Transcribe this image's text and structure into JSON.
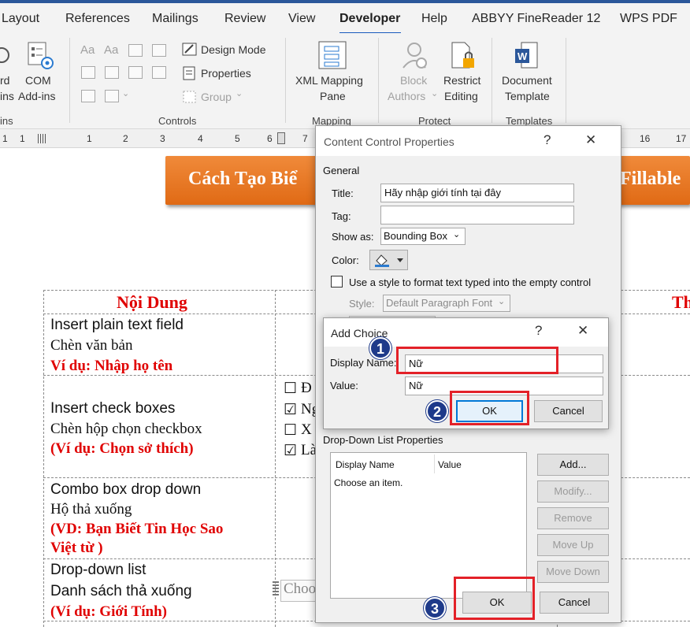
{
  "ribbon": {
    "tabs": [
      "Layout",
      "References",
      "Mailings",
      "Review",
      "View",
      "Developer",
      "Help",
      "ABBYY FineReader 12",
      "WPS PDF"
    ],
    "active_tab": "Developer",
    "addins": {
      "partial_label_1": "rd",
      "partial_label_2": "ins",
      "com_label_1": "COM",
      "com_label_2": "Add-ins",
      "group_partial": "ins"
    },
    "controls": {
      "design_mode": "Design Mode",
      "properties": "Properties",
      "group": "Group",
      "group_label": "Controls"
    },
    "mapping": {
      "xml_label_1": "XML Mapping",
      "xml_label_2": "Pane",
      "group_label": "Mapping"
    },
    "protect": {
      "block_1": "Block",
      "block_2": "Authors",
      "restrict_1": "Restrict",
      "restrict_2": "Editing",
      "group_label": "Protect"
    },
    "templates": {
      "doc_1": "Document",
      "doc_2": "Template",
      "group_label": "Templates"
    }
  },
  "ruler": {
    "left_numbers": [
      "1",
      "1",
      "1",
      "2",
      "3",
      "4",
      "5",
      "6",
      "7"
    ],
    "right_numbers": [
      "16",
      "17"
    ]
  },
  "document": {
    "banner_left": "Cách Tạo Biể",
    "banner_right": "(Fillable",
    "col1_header": "Nội Dung",
    "col3_header_partial": "Th",
    "rows": [
      {
        "line1": "Insert plain text field",
        "line2": "Chèn văn bản",
        "example": "Ví dụ: Nhập họ tên"
      },
      {
        "line1": "Insert check boxes",
        "line2": "Chèn hộp chọn checkbox",
        "example": "(Ví dụ: Chọn sở thích)"
      },
      {
        "line1": "Combo box drop down",
        "line2": "Hộ thả xuống",
        "example1": "(VD: Bạn Biết Tin Học Sao",
        "example2": "Việt từ )"
      },
      {
        "line1": "Drop-down list",
        "line2": "Danh sách thả xuống",
        "example": "(Ví dụ: Giới Tính)"
      }
    ],
    "checkbox_items": [
      {
        "symbol": "☐",
        "text": "Đ"
      },
      {
        "symbol": "☑",
        "text": "Ng"
      },
      {
        "symbol": "☐",
        "text": "X"
      },
      {
        "symbol": "☑",
        "text": "Là"
      }
    ],
    "dropdown_partial": "Choo"
  },
  "content_control_dialog": {
    "title": "Content Control Properties",
    "help": "?",
    "close": "✕",
    "general_label": "General",
    "title_label": "Title:",
    "title_value": "Hãy nhập giới tính tại đây",
    "tag_label": "Tag:",
    "tag_value": "",
    "show_as_label": "Show as:",
    "show_as_value": "Bounding Box",
    "color_label": "Color:",
    "use_style_label": "Use a style to format text typed into the empty control",
    "style_label": "Style:",
    "style_value": "Default Paragraph Font",
    "dropdown_list_label": "Drop-Down List Properties",
    "list_headers": [
      "Display Name",
      "Value"
    ],
    "list_items": [
      "Choose an item."
    ],
    "buttons": {
      "add": "Add...",
      "modify": "Modify...",
      "remove": "Remove",
      "move_up": "Move Up",
      "move_down": "Move Down",
      "ok": "OK",
      "cancel": "Cancel"
    }
  },
  "add_choice_dialog": {
    "title": "Add Choice",
    "help": "?",
    "close": "✕",
    "display_name_label": "Display Name:",
    "display_name_value": "Nữ",
    "value_label": "Value:",
    "value_value": "Nữ",
    "ok": "OK",
    "cancel": "Cancel"
  },
  "annotations": {
    "badge1": "1",
    "badge2": "2",
    "badge3": "3",
    "highlight_color": "#e32128",
    "badge_color": "#1e3a8a"
  },
  "colors": {
    "accent": "#2b579a",
    "banner": "#e87a25",
    "red_text": "#e00000"
  }
}
